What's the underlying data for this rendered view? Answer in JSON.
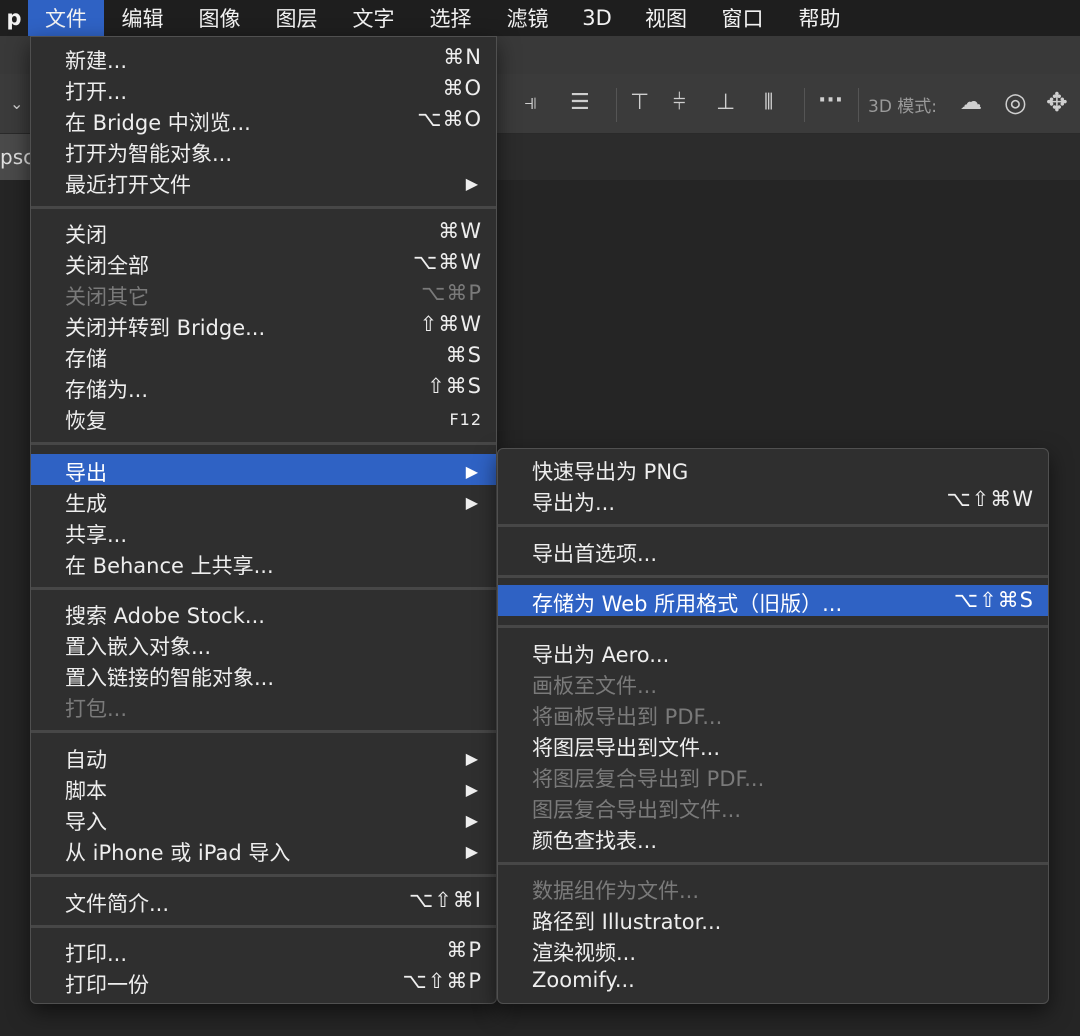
{
  "menubar": {
    "app_fragment": "p",
    "items": [
      "文件",
      "编辑",
      "图像",
      "图层",
      "文字",
      "选择",
      "滤镜",
      "3D",
      "视图",
      "窗口",
      "帮助"
    ],
    "active_index": 0
  },
  "toolbar": {
    "mode3d_label": "3D 模式:",
    "icons": [
      "align-top-icon",
      "align-vcenter-icon",
      "align-bottom-icon",
      "distribute-icon",
      "more-icon",
      "orbit-3d-icon",
      "roll-3d-icon",
      "pan-3d-icon"
    ]
  },
  "document_tab": {
    "label": "psc"
  },
  "file_menu": {
    "items": [
      {
        "label": "新建...",
        "shortcut": "⌘N"
      },
      {
        "label": "打开...",
        "shortcut": "⌘O"
      },
      {
        "label": "在 Bridge 中浏览...",
        "shortcut": "⌥⌘O"
      },
      {
        "label": "打开为智能对象...",
        "shortcut": ""
      },
      {
        "label": "最近打开文件",
        "shortcut": "",
        "submenu": true
      },
      {
        "label": "关闭",
        "shortcut": "⌘W"
      },
      {
        "label": "关闭全部",
        "shortcut": "⌥⌘W"
      },
      {
        "label": "关闭其它",
        "shortcut": "⌥⌘P",
        "disabled": true
      },
      {
        "label": "关闭并转到 Bridge...",
        "shortcut": "⇧⌘W"
      },
      {
        "label": "存储",
        "shortcut": "⌘S"
      },
      {
        "label": "存储为...",
        "shortcut": "⇧⌘S"
      },
      {
        "label": "恢复",
        "shortcut": "F12"
      },
      {
        "label": "导出",
        "shortcut": "",
        "submenu": true,
        "highlighted": true
      },
      {
        "label": "生成",
        "shortcut": "",
        "submenu": true
      },
      {
        "label": "共享...",
        "shortcut": ""
      },
      {
        "label": "在 Behance 上共享...",
        "shortcut": ""
      },
      {
        "label": "搜索 Adobe Stock...",
        "shortcut": ""
      },
      {
        "label": "置入嵌入对象...",
        "shortcut": ""
      },
      {
        "label": "置入链接的智能对象...",
        "shortcut": ""
      },
      {
        "label": "打包...",
        "shortcut": "",
        "disabled": true
      },
      {
        "label": "自动",
        "shortcut": "",
        "submenu": true
      },
      {
        "label": "脚本",
        "shortcut": "",
        "submenu": true
      },
      {
        "label": "导入",
        "shortcut": "",
        "submenu": true
      },
      {
        "label": "从 iPhone 或 iPad 导入",
        "shortcut": "",
        "submenu": true
      },
      {
        "label": "文件简介...",
        "shortcut": "⌥⇧⌘I"
      },
      {
        "label": "打印...",
        "shortcut": "⌘P"
      },
      {
        "label": "打印一份",
        "shortcut": "⌥⇧⌘P"
      }
    ]
  },
  "export_submenu": {
    "items": [
      {
        "label": "快速导出为 PNG",
        "shortcut": ""
      },
      {
        "label": "导出为...",
        "shortcut": "⌥⇧⌘W"
      },
      {
        "label": "导出首选项...",
        "shortcut": ""
      },
      {
        "label": "存储为 Web 所用格式（旧版）...",
        "shortcut": "⌥⇧⌘S",
        "highlighted": true
      },
      {
        "label": "导出为 Aero...",
        "shortcut": ""
      },
      {
        "label": "画板至文件...",
        "shortcut": "",
        "disabled": true
      },
      {
        "label": "将画板导出到 PDF...",
        "shortcut": "",
        "disabled": true
      },
      {
        "label": "将图层导出到文件...",
        "shortcut": ""
      },
      {
        "label": "将图层复合导出到 PDF...",
        "shortcut": "",
        "disabled": true
      },
      {
        "label": "图层复合导出到文件...",
        "shortcut": "",
        "disabled": true
      },
      {
        "label": "颜色查找表...",
        "shortcut": ""
      },
      {
        "label": "数据组作为文件...",
        "shortcut": "",
        "disabled": true
      },
      {
        "label": "路径到 Illustrator...",
        "shortcut": ""
      },
      {
        "label": "渲染视频...",
        "shortcut": ""
      },
      {
        "label": "Zoomify...",
        "shortcut": ""
      }
    ]
  },
  "colors": {
    "highlight": "#2f62c4",
    "menu_bg": "#2f2f2f",
    "disabled_text": "#7a7a7a"
  }
}
